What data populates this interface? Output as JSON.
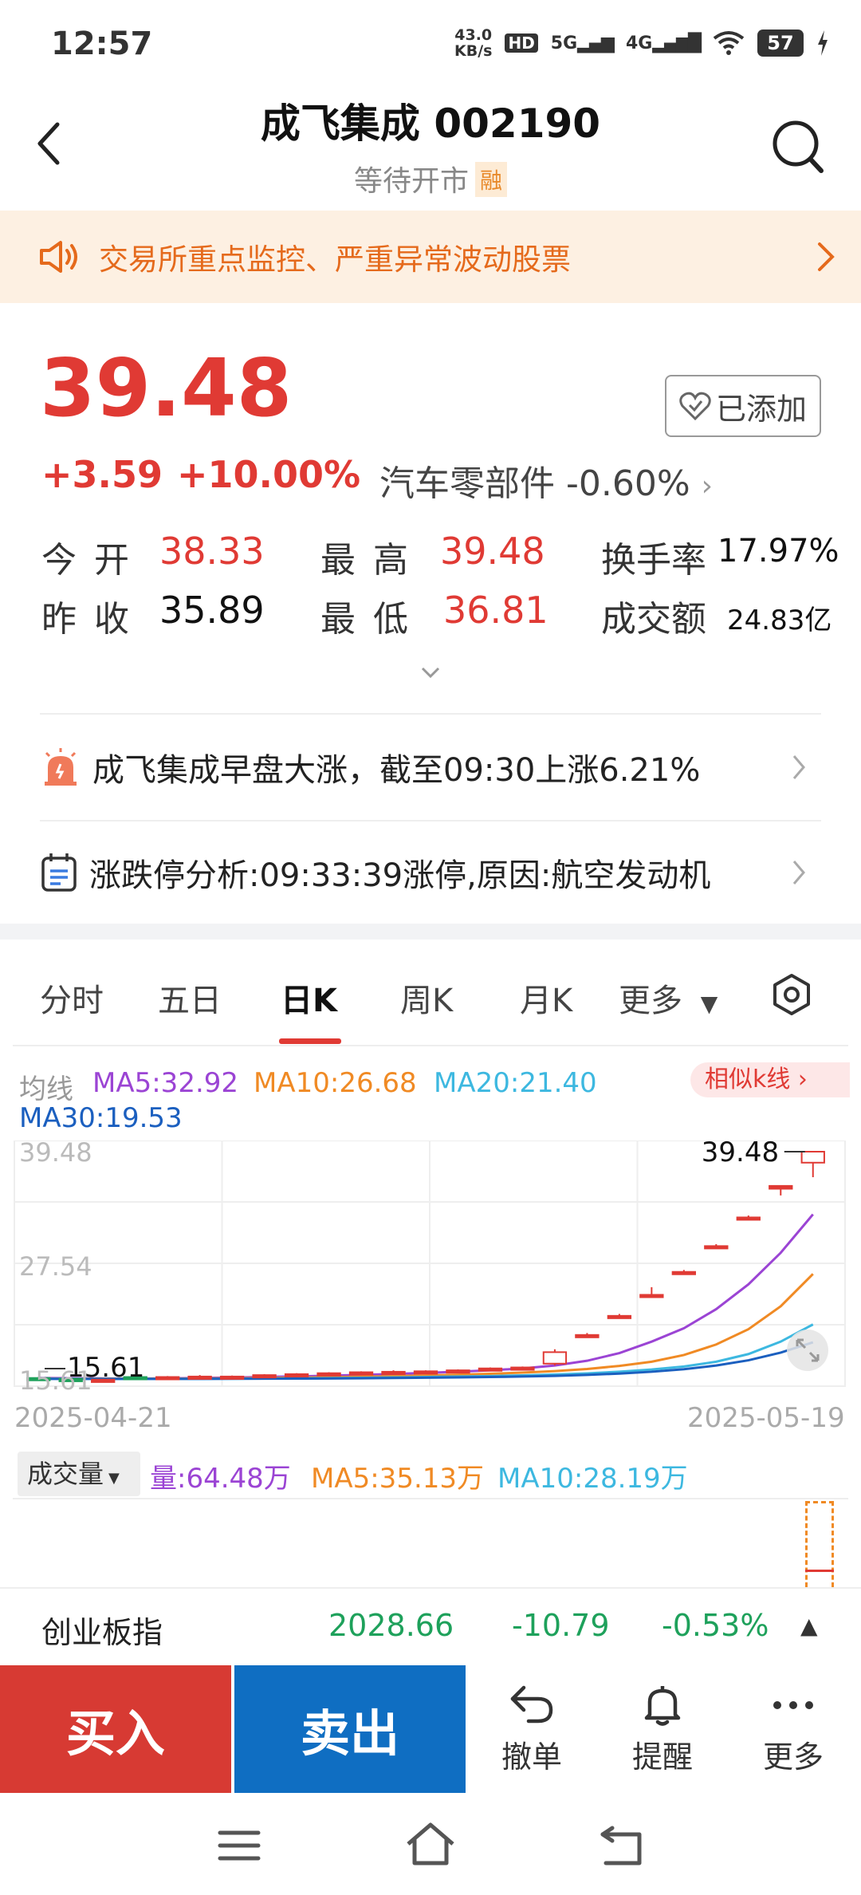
{
  "status_bar": {
    "time": "12:57",
    "net_speed_value": "43.0",
    "net_speed_unit": "KB/s",
    "hd_label": "HD",
    "sig1": "5G",
    "sig2": "4G",
    "battery": "57"
  },
  "header": {
    "title": "成飞集成 002190",
    "subtitle": "等待开市",
    "margin_tag": "融"
  },
  "alert": {
    "text": "交易所重点监控、严重异常波动股票"
  },
  "quote": {
    "price": "39.48",
    "change": "+3.59",
    "change_pct": "+10.00%",
    "sector": "汽车零部件 -0.60%",
    "watch_label": "已添加",
    "open_label": "今 开",
    "open_value": "38.33",
    "high_label": "最 高",
    "high_value": "39.48",
    "turnover_label": "换手率",
    "turnover_value": "17.97%",
    "prev_label": "昨 收",
    "prev_value": "35.89",
    "low_label": "最 低",
    "low_value": "36.81",
    "amount_label": "成交额",
    "amount_value": "24.83亿"
  },
  "news": [
    {
      "text": "成飞集成早盘大涨，截至09:30上涨6.21%"
    },
    {
      "text": "涨跌停分析:09:33:39涨停,原因:航空发动机"
    }
  ],
  "tabs": [
    "分时",
    "五日",
    "日K",
    "周K",
    "月K",
    "更多"
  ],
  "active_tab": "日K",
  "ma": {
    "label": "均线",
    "ma5": "MA5:32.92",
    "ma10": "MA10:26.68",
    "ma20": "MA20:21.40",
    "ma30": "MA30:19.53",
    "similar": "相似k线"
  },
  "chart_data": {
    "type": "candlestick",
    "x_start": "2025-04-21",
    "x_end": "2025-05-19",
    "y_labels": [
      "39.48",
      "27.54",
      "15.61"
    ],
    "max_label": "39.48",
    "min_label": "15.61",
    "ylim": [
      15.61,
      39.48
    ],
    "candles": [
      {
        "o": 15.8,
        "c": 15.75,
        "h": 15.9,
        "l": 15.61
      },
      {
        "o": 15.7,
        "c": 15.65,
        "h": 15.8,
        "l": 15.61
      },
      {
        "o": 15.6,
        "c": 15.62,
        "h": 15.7,
        "l": 15.55
      },
      {
        "o": 15.9,
        "c": 15.8,
        "h": 16.0,
        "l": 15.7
      },
      {
        "o": 15.8,
        "c": 15.9,
        "h": 16.0,
        "l": 15.7
      },
      {
        "o": 15.9,
        "c": 15.95,
        "h": 16.1,
        "l": 15.8
      },
      {
        "o": 15.9,
        "c": 15.95,
        "h": 16.05,
        "l": 15.85
      },
      {
        "o": 16.0,
        "c": 16.1,
        "h": 16.2,
        "l": 15.9
      },
      {
        "o": 16.1,
        "c": 16.2,
        "h": 16.3,
        "l": 16.0
      },
      {
        "o": 16.2,
        "c": 16.3,
        "h": 16.4,
        "l": 16.1
      },
      {
        "o": 16.3,
        "c": 16.4,
        "h": 16.5,
        "l": 16.2
      },
      {
        "o": 16.4,
        "c": 16.45,
        "h": 16.6,
        "l": 16.3
      },
      {
        "o": 16.45,
        "c": 16.5,
        "h": 16.6,
        "l": 16.4
      },
      {
        "o": 16.5,
        "c": 16.6,
        "h": 16.7,
        "l": 16.4
      },
      {
        "o": 16.7,
        "c": 16.8,
        "h": 16.9,
        "l": 16.6
      },
      {
        "o": 16.8,
        "c": 16.9,
        "h": 17.0,
        "l": 16.7
      },
      {
        "o": 17.3,
        "c": 18.5,
        "h": 18.8,
        "l": 17.1
      },
      {
        "o": 20.3,
        "c": 20.3,
        "h": 20.5,
        "l": 20.1
      },
      {
        "o": 22.3,
        "c": 22.3,
        "h": 22.5,
        "l": 22.1
      },
      {
        "o": 24.5,
        "c": 24.5,
        "h": 25.3,
        "l": 24.3
      },
      {
        "o": 26.9,
        "c": 26.9,
        "h": 27.1,
        "l": 26.7
      },
      {
        "o": 29.6,
        "c": 29.6,
        "h": 29.8,
        "l": 29.4
      },
      {
        "o": 32.6,
        "c": 32.6,
        "h": 32.8,
        "l": 32.4
      },
      {
        "o": 35.6,
        "c": 35.9,
        "h": 35.9,
        "l": 34.9
      },
      {
        "o": 38.33,
        "c": 39.48,
        "h": 39.48,
        "l": 36.81
      }
    ],
    "ma_series": [
      {
        "name": "MA5",
        "color": "#9b44d4",
        "values": [
          15.8,
          15.78,
          15.75,
          15.74,
          15.76,
          15.8,
          15.84,
          15.9,
          15.96,
          16.04,
          16.12,
          16.22,
          16.33,
          16.45,
          16.6,
          16.8,
          17.1,
          17.6,
          18.4,
          19.6,
          21.0,
          23.0,
          25.6,
          28.9,
          32.92
        ]
      },
      {
        "name": "MA10",
        "color": "#f08a24",
        "values": [
          15.75,
          15.74,
          15.73,
          15.72,
          15.73,
          15.75,
          15.77,
          15.8,
          15.84,
          15.88,
          15.93,
          15.99,
          16.06,
          16.14,
          16.24,
          16.36,
          16.52,
          16.74,
          17.06,
          17.5,
          18.2,
          19.3,
          20.9,
          23.3,
          26.68
        ]
      },
      {
        "name": "MA20",
        "color": "#3db8e0",
        "values": [
          15.72,
          15.71,
          15.7,
          15.7,
          15.7,
          15.71,
          15.72,
          15.74,
          15.76,
          15.79,
          15.82,
          15.86,
          15.9,
          15.95,
          16.0,
          16.07,
          16.16,
          16.28,
          16.45,
          16.68,
          17.0,
          17.5,
          18.3,
          19.6,
          21.4
        ]
      },
      {
        "name": "MA30",
        "color": "#1b5fbf",
        "values": [
          15.7,
          15.7,
          15.7,
          15.7,
          15.7,
          15.7,
          15.71,
          15.72,
          15.73,
          15.75,
          15.77,
          15.8,
          15.83,
          15.86,
          15.9,
          15.95,
          16.02,
          16.12,
          16.26,
          16.45,
          16.72,
          17.1,
          17.65,
          18.45,
          19.53
        ]
      }
    ]
  },
  "volume": {
    "selector": "成交量",
    "vol": "量:64.48万",
    "ma5": "MA5:35.13万",
    "ma10": "MA10:28.19万"
  },
  "index": {
    "name": "创业板指",
    "value": "2028.66",
    "change": "-10.79",
    "change_pct": "-0.53%"
  },
  "actions": {
    "buy": "买入",
    "sell": "卖出",
    "cancel": "撤单",
    "alert": "提醒",
    "more": "更多"
  },
  "colors": {
    "up": "#e03a34",
    "down": "#1ea15b",
    "buy_bg": "#d73a33",
    "sell_bg": "#0f6ec2",
    "alert_bg": "#fdf0e2",
    "alert_text": "#e56a1c"
  }
}
